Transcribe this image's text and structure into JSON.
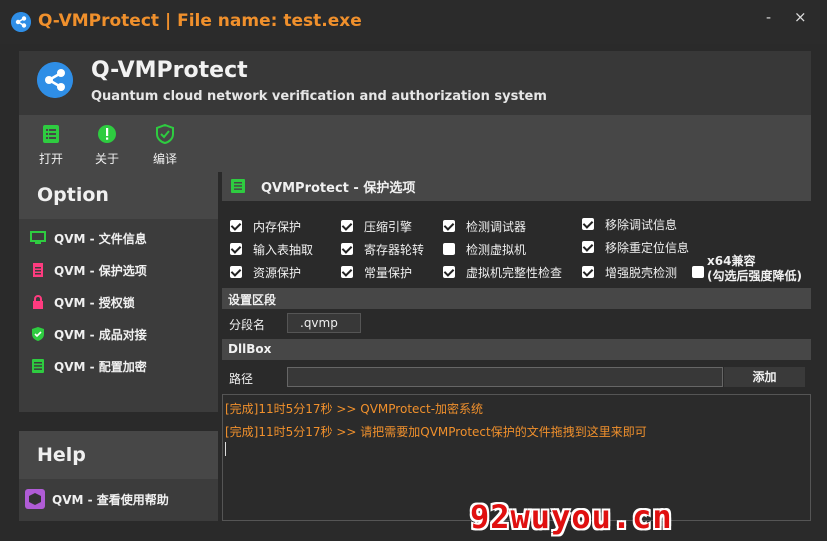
{
  "window": {
    "title": "Q-VMProtect | File name: test.exe",
    "minimize": "-",
    "close": "×"
  },
  "header": {
    "title": "Q-VMProtect",
    "subtitle": "Quantum cloud network verification and authorization system"
  },
  "toolbar": {
    "open": "打开",
    "about": "关于",
    "compile": "编译"
  },
  "sidebar": {
    "title": "Option",
    "items": [
      {
        "label": "QVM - 文件信息",
        "icon": "monitor-icon",
        "color": "#2ecc40"
      },
      {
        "label": "QVM - 保护选项",
        "icon": "document-icon",
        "color": "#ff3b7f"
      },
      {
        "label": "QVM - 授权锁",
        "icon": "lock-icon",
        "color": "#ff3b7f"
      },
      {
        "label": "QVM - 成品对接",
        "icon": "shield-check-icon",
        "color": "#2ecc40"
      },
      {
        "label": "QVM - 配置加密",
        "icon": "list-icon",
        "color": "#2ecc40"
      }
    ]
  },
  "help": {
    "title": "Help",
    "item": "QVM - 查看使用帮助"
  },
  "protect": {
    "title": "QVMProtect - 保护选项",
    "options": [
      {
        "label": "内存保护",
        "checked": true
      },
      {
        "label": "压缩引擎",
        "checked": true
      },
      {
        "label": "检测调试器",
        "checked": true
      },
      {
        "label": "移除调试信息",
        "checked": true
      },
      {
        "label": "输入表抽取",
        "checked": true
      },
      {
        "label": "寄存器轮转",
        "checked": true
      },
      {
        "label": "检测虚拟机",
        "checked": false
      },
      {
        "label": "移除重定位信息",
        "checked": true
      },
      {
        "label": "资源保护",
        "checked": true
      },
      {
        "label": "常量保护",
        "checked": true
      },
      {
        "label": "虚拟机完整性检查",
        "checked": true
      },
      {
        "label": "增强脱壳检测",
        "checked": true
      }
    ],
    "x64": {
      "line1": "x64兼容",
      "line2": "(勾选后强度降低)",
      "checked": false
    }
  },
  "section": {
    "title": "设置区段",
    "segment_label": "分段名",
    "segment_value": ".qvmp"
  },
  "dllbox": {
    "title": "DllBox",
    "path_label": "路径",
    "path_value": "",
    "add_button": "添加"
  },
  "log": [
    "[完成]11时5分17秒 >> QVMProtect-加密系统",
    "[完成]11时5分17秒 >> 请把需要加QVMProtect保护的文件拖拽到这里来即可"
  ],
  "watermark": "92wuyou.cn",
  "colors": {
    "accent": "#f0902c",
    "green": "#2ecc40",
    "pink": "#ff3b7f",
    "blue": "#2f8ee6"
  }
}
